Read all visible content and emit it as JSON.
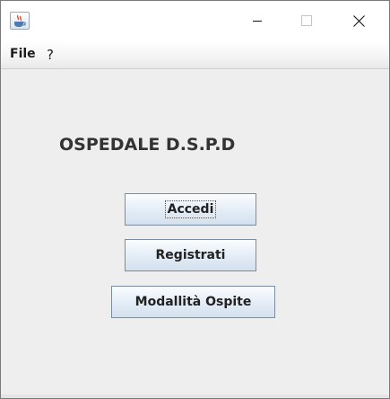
{
  "window": {
    "title": "",
    "controls": {
      "minimize": "minimize",
      "maximize": "maximize",
      "close": "close"
    }
  },
  "menubar": {
    "items": [
      {
        "label": "File"
      },
      {
        "label": "?"
      }
    ]
  },
  "main": {
    "heading": "OSPEDALE D.S.P.D",
    "buttons": [
      {
        "label": "Accedi",
        "focused": true
      },
      {
        "label": "Registrati",
        "focused": false
      },
      {
        "label": "Modallità Ospite",
        "focused": false
      }
    ]
  },
  "icons": {
    "app": "java-coffee-cup-icon",
    "minimize": "minimize-icon",
    "maximize": "maximize-icon",
    "close": "close-icon"
  },
  "colors": {
    "window_bg": "#eeeeee",
    "titlebar_bg": "#ffffff",
    "heading_text": "#333333",
    "button_top": "#fbfdff",
    "button_bottom": "#d3e0ee",
    "button_border": "#7b8da3"
  }
}
